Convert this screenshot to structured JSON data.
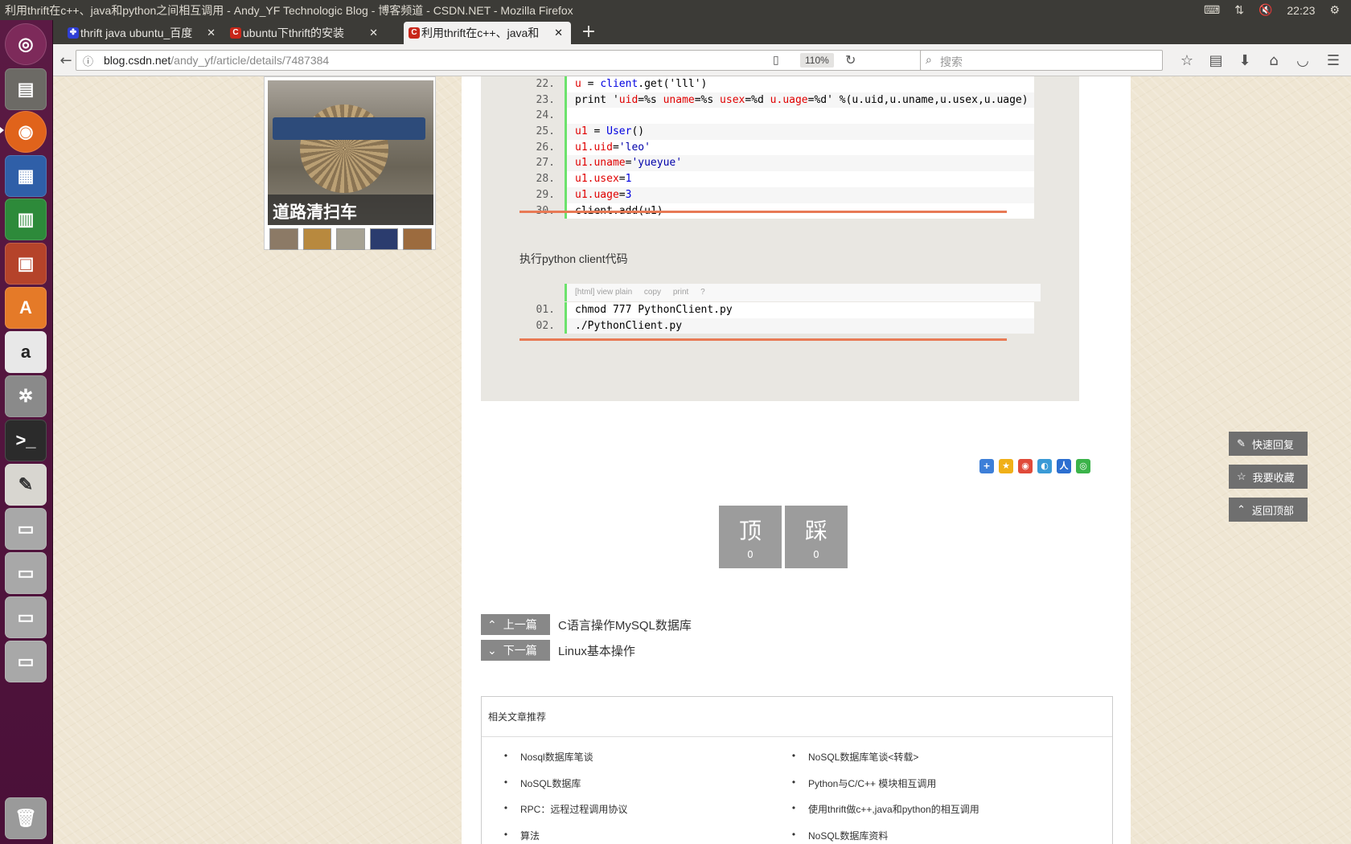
{
  "window": {
    "title": "利用thrift在c++、java和python之间相互调用 - Andy_YF Technologic Blog - 博客频道 - CSDN.NET - Mozilla Firefox",
    "clock": "22:23"
  },
  "tabs": [
    {
      "label": "thrift java ubuntu_百度",
      "favicon": "baidu-icon",
      "color": "#2f3fd6"
    },
    {
      "label": "ubuntu下thrift的安装",
      "favicon": "csdn-icon",
      "color": "#c8271a"
    },
    {
      "label": "利用thrift在c++、java和",
      "favicon": "csdn-icon",
      "color": "#c8271a"
    }
  ],
  "nav": {
    "url_host": "blog.csdn.net",
    "url_path": "/andy_yf/article/details/7487384",
    "zoom": "110%",
    "search_placeholder": "搜索"
  },
  "ad": {
    "caption": "道路清扫车"
  },
  "code1": {
    "lines": [
      {
        "n": "22.",
        "parts": [
          [
            "u",
            "red"
          ],
          [
            " = ",
            ""
          ],
          [
            "client",
            "blue"
          ],
          [
            ".get('lll')",
            ""
          ]
        ]
      },
      {
        "n": "23.",
        "parts": [
          [
            "print '",
            ""
          ],
          [
            "uid",
            "red"
          ],
          [
            "=%s ",
            ""
          ],
          [
            "uname",
            "red"
          ],
          [
            "=%s ",
            ""
          ],
          [
            "usex",
            "red"
          ],
          [
            "=%d ",
            ""
          ],
          [
            "u.uage",
            "red"
          ],
          [
            "=%d' %(u.uid,u.uname,u.usex,u.uage)",
            ""
          ]
        ]
      },
      {
        "n": "24.",
        "parts": [
          [
            "",
            ""
          ]
        ]
      },
      {
        "n": "25.",
        "parts": [
          [
            "u1",
            "red"
          ],
          [
            " = ",
            ""
          ],
          [
            "User",
            "blue"
          ],
          [
            "()",
            ""
          ]
        ]
      },
      {
        "n": "26.",
        "parts": [
          [
            "u1.uid",
            "red"
          ],
          [
            "=",
            ""
          ],
          [
            "'leo'",
            "str"
          ]
        ]
      },
      {
        "n": "27.",
        "parts": [
          [
            "u1.uname",
            "red"
          ],
          [
            "=",
            ""
          ],
          [
            "'yueyue'",
            "str"
          ]
        ]
      },
      {
        "n": "28.",
        "parts": [
          [
            "u1.usex",
            "red"
          ],
          [
            "=",
            ""
          ],
          [
            "1",
            "blue"
          ]
        ]
      },
      {
        "n": "29.",
        "parts": [
          [
            "u1.uage",
            "red"
          ],
          [
            "=",
            ""
          ],
          [
            "3",
            "blue"
          ]
        ]
      },
      {
        "n": "30.",
        "parts": [
          [
            "client.add(u1)",
            ""
          ]
        ]
      }
    ]
  },
  "para1": "执行python client代码",
  "code2": {
    "toolbar": [
      "[html] view plain",
      "copy",
      "print",
      "?"
    ],
    "lines": [
      {
        "n": "01.",
        "parts": [
          [
            "chmod 777 PythonClient.py",
            ""
          ]
        ]
      },
      {
        "n": "02.",
        "parts": [
          [
            "./PythonClient.py",
            ""
          ]
        ]
      }
    ]
  },
  "votes": [
    {
      "label": "顶",
      "count": "0"
    },
    {
      "label": "踩",
      "count": "0"
    }
  ],
  "prev": {
    "button": "上一篇",
    "link": "C语言操作MySQL数据库"
  },
  "next": {
    "button": "下一篇",
    "link": "Linux基本操作"
  },
  "related": {
    "title": "相关文章推荐",
    "left": [
      "Nosql数据库笔谈",
      "NoSQL数据库",
      "RPC：远程过程调用协议",
      "算法"
    ],
    "right": [
      "NoSQL数据库笔谈<转载>",
      "Python与C/C++ 模块相互调用",
      "使用thrift做c++,java和python的相互调用",
      "NoSQL数据库资料"
    ]
  },
  "side": {
    "reply": "快速回复",
    "favorite": "我要收藏",
    "top": "返回顶部"
  }
}
